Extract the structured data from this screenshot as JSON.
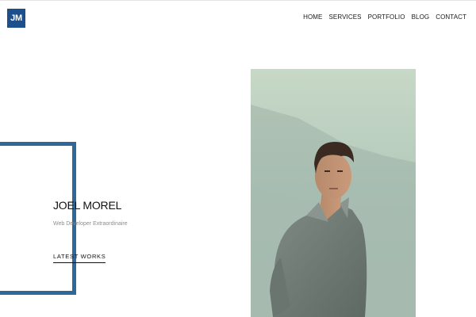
{
  "header": {
    "logo_text": "JM",
    "nav": [
      "HOME",
      "SERVICES",
      "PORTFOLIO",
      "BLOG",
      "CONTACT"
    ]
  },
  "hero": {
    "name": "JOEL MOREL",
    "subtitle": "Web Developer Extraordinaire",
    "cta": "LATEST WORKS"
  },
  "colors": {
    "accent": "#2f6799",
    "logo_bg": "#1d4f8c"
  }
}
